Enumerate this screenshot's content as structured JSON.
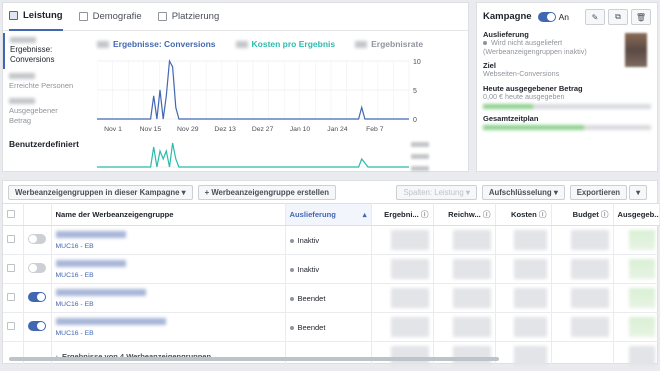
{
  "tabs": [
    {
      "label": "Leistung"
    },
    {
      "label": "Demografie"
    },
    {
      "label": "Platzierung"
    }
  ],
  "left_nav": {
    "item0": "Ergebnisse: Conversions",
    "item1": "Erreichte Personen",
    "item2": "Ausgegebener Betrag",
    "custom": "Benutzerdefiniert"
  },
  "legend": {
    "results": "Ergebnisse: Conversions",
    "cost": "Kosten pro Ergebnis",
    "rate": "Ergebnisrate"
  },
  "chart_data": {
    "type": "line",
    "x_ticks": [
      "Nov 1",
      "Nov 15",
      "Nov 29",
      "Dez 13",
      "Dez 27",
      "Jan 10",
      "Jan 24",
      "Feb 7"
    ],
    "y_ticks": [
      10,
      5,
      0
    ],
    "series": [
      {
        "name": "Ergebnisse: Conversions",
        "color": "#4267b2",
        "values": [
          0,
          0,
          0,
          0,
          0,
          0,
          0,
          0,
          0,
          0,
          0,
          0,
          0,
          0,
          0,
          0,
          0,
          0,
          4,
          0,
          5,
          0,
          4,
          10,
          9,
          2,
          0,
          0,
          0,
          0,
          0,
          0,
          0,
          0,
          0,
          0,
          0,
          0,
          0,
          0,
          0,
          0,
          0,
          0,
          0,
          0,
          0,
          0,
          0,
          0,
          0,
          0,
          0,
          0,
          0,
          0,
          0,
          0,
          0,
          0,
          0,
          0,
          0,
          0,
          0,
          0,
          0,
          0,
          0,
          0,
          0,
          0,
          0,
          0,
          0,
          0,
          0,
          0,
          0,
          0,
          0,
          0,
          0,
          0,
          2,
          0,
          0,
          0,
          0,
          0,
          0,
          0,
          0,
          0,
          0,
          0,
          0,
          0,
          0,
          0
        ]
      },
      {
        "name": "Kosten pro Ergebnis",
        "color": "#2bbbad",
        "values": [
          0,
          0,
          0,
          0,
          0,
          0,
          0,
          0,
          0,
          0,
          0,
          0,
          0,
          0,
          0,
          0,
          0,
          0,
          5,
          0,
          4,
          2,
          4,
          0,
          6,
          2,
          0,
          0,
          0,
          0,
          0,
          0,
          0,
          0,
          0,
          0,
          0,
          0,
          0,
          0,
          0,
          0,
          0,
          0,
          0,
          0,
          0,
          0,
          0,
          0,
          0,
          0,
          0,
          0,
          0,
          0,
          0,
          0,
          0,
          0,
          0,
          0,
          0,
          0,
          0,
          0,
          0,
          0,
          0,
          0,
          0,
          0,
          0,
          0,
          0,
          0,
          0,
          0,
          0,
          0,
          0,
          0,
          0,
          0,
          2,
          1,
          0,
          0,
          0,
          0,
          0,
          0,
          0,
          0,
          0,
          0,
          0,
          0,
          0,
          0
        ]
      }
    ],
    "ylim": [
      0,
      10
    ],
    "grid": true
  },
  "campaign": {
    "title": "Kampagne",
    "status": "An",
    "delivery_label": "Auslieferung",
    "delivery_value": "Wird nicht ausgeliefert",
    "delivery_note": "(Werbeanzeigengruppen inaktiv)",
    "goal_label": "Ziel",
    "goal_value": "Webseiten-Conversions",
    "spent_label": "Heute ausgegebener Betrag",
    "spent_value": "0,00 € heute ausgegeben",
    "schedule_label": "Gesamtzeitplan"
  },
  "toolbar": {
    "adsets_dropdown": "Werbeanzeigengruppen in dieser Kampagne",
    "create_button": "Werbeanzeigengruppe erstellen",
    "columns_button": "Spalten: Leistung",
    "breakdown_button": "Aufschlüsselung",
    "export_button": "Exportieren"
  },
  "table": {
    "headers": [
      "Name der Werbeanzeigengruppe",
      "Auslieferung",
      "Ergebni...",
      "Reichw...",
      "Kosten",
      "Budget",
      "Ausgegeb..."
    ],
    "rows": [
      {
        "sub": "MUC16 - EB",
        "delivery": "Inaktiv",
        "on": false
      },
      {
        "sub": "MUC16 - EB",
        "delivery": "Inaktiv",
        "on": false
      },
      {
        "sub": "MUC16 - EB",
        "delivery": "Beendet",
        "on": true
      },
      {
        "sub": "MUC16 - EB",
        "delivery": "Beendet",
        "on": true
      }
    ],
    "summary": "Ergebnisse von 4 Werbeanzeigengruppen"
  }
}
